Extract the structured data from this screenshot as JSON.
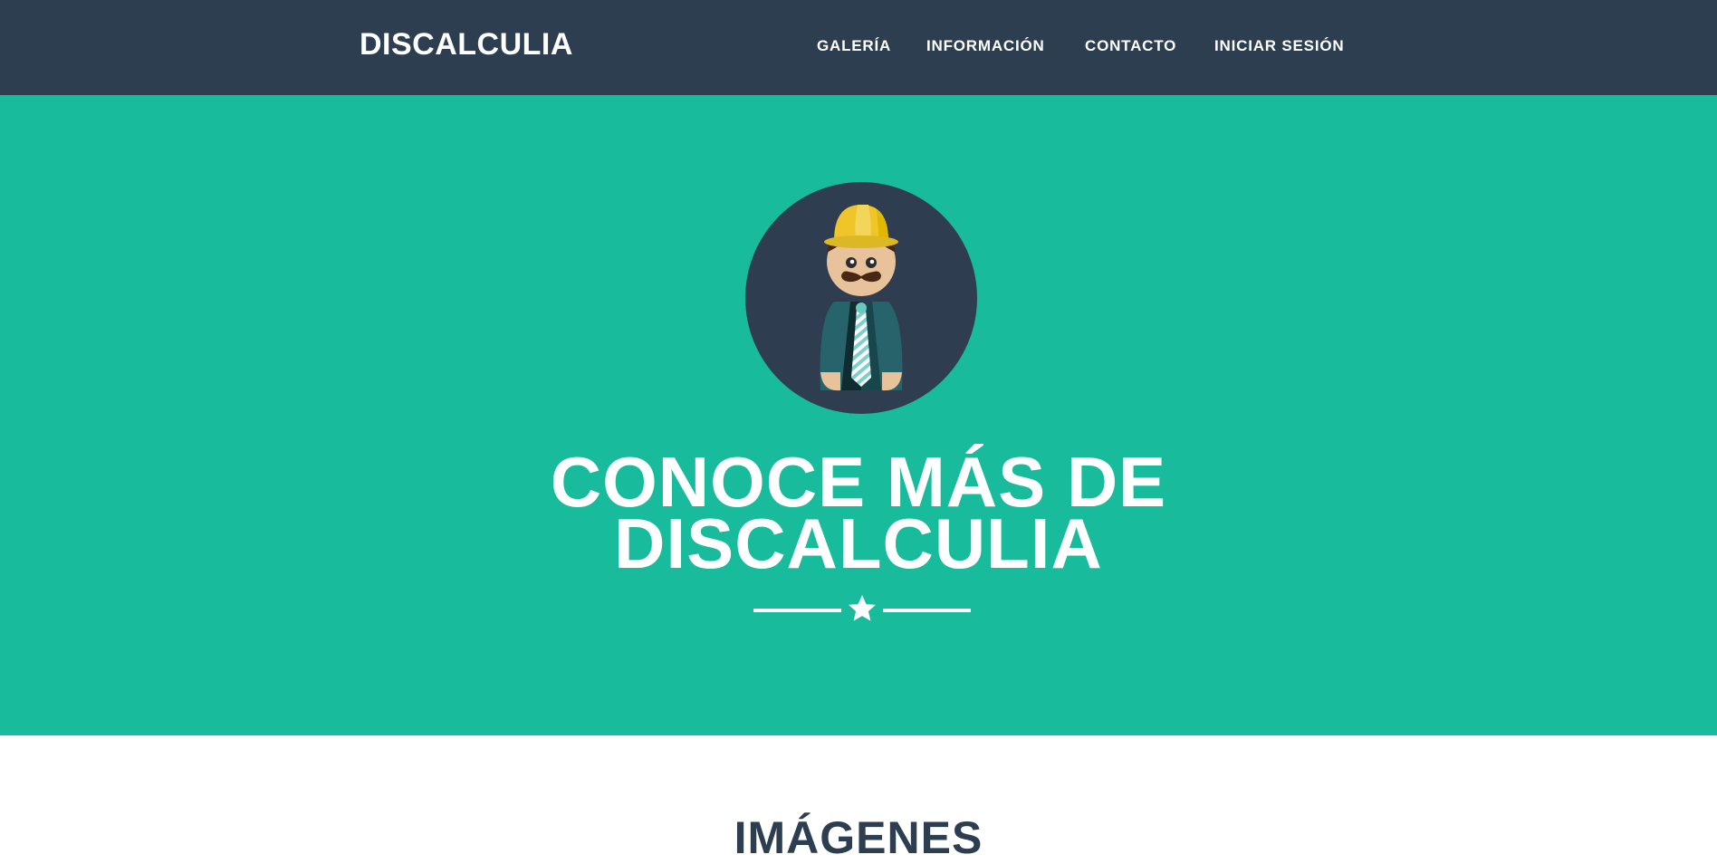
{
  "navbar": {
    "brand": "DISCALCULIA",
    "items": [
      {
        "label": "GALERÍA"
      },
      {
        "label": "INFORMACIÓN"
      },
      {
        "label": "CONTACTO"
      },
      {
        "label": "INICIAR SESIÓN"
      }
    ]
  },
  "hero": {
    "title_line1": "CONOCE MÁS DE",
    "title_line2": "DISCALCULIA",
    "divider_icon": "star-icon"
  },
  "section": {
    "title": "IMÁGENES"
  },
  "colors": {
    "navbar": "#2c3e50",
    "hero": "#18bc9c",
    "text_dark": "#2c3e50"
  }
}
